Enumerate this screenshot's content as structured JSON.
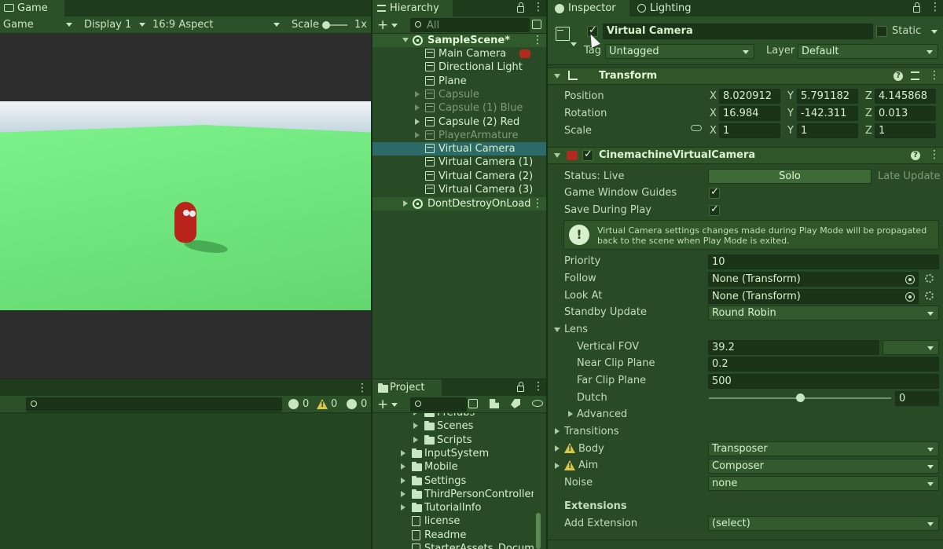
{
  "game": {
    "tab_label": "Game",
    "mode": "Game",
    "display": "Display 1",
    "aspect": "16:9 Aspect",
    "scale_label": "Scale",
    "scale_value": "1x"
  },
  "console": {
    "count_info": "0",
    "count_warn": "0",
    "count_error": "0"
  },
  "hierarchy": {
    "tab_label": "Hierarchy",
    "search_placeholder": "All",
    "scene": "SampleScene*",
    "items": [
      {
        "label": "Main Camera",
        "dim": false,
        "fold": false
      },
      {
        "label": "Directional Light",
        "dim": false,
        "fold": false
      },
      {
        "label": "Plane",
        "dim": false,
        "fold": false
      },
      {
        "label": "Capsule",
        "dim": true,
        "fold": true
      },
      {
        "label": "Capsule (1) Blue",
        "dim": true,
        "fold": true
      },
      {
        "label": "Capsule (2) Red",
        "dim": false,
        "fold": true
      },
      {
        "label": "PlayerArmature",
        "dim": true,
        "fold": true
      },
      {
        "label": "Virtual Camera",
        "dim": false,
        "fold": false,
        "selected": true
      },
      {
        "label": "Virtual Camera (1)",
        "dim": false,
        "fold": false
      },
      {
        "label": "Virtual Camera (2)",
        "dim": false,
        "fold": false
      },
      {
        "label": "Virtual Camera (3)",
        "dim": false,
        "fold": false
      }
    ],
    "dontdestroy": "DontDestroyOnLoad"
  },
  "project": {
    "tab_label": "Project",
    "items": [
      {
        "label": "Prefabs",
        "type": "folder",
        "indent": 2
      },
      {
        "label": "Scenes",
        "type": "folder",
        "indent": 2
      },
      {
        "label": "Scripts",
        "type": "folder",
        "indent": 2
      },
      {
        "label": "InputSystem",
        "type": "folder",
        "indent": 1
      },
      {
        "label": "Mobile",
        "type": "folder",
        "indent": 1
      },
      {
        "label": "Settings",
        "type": "folder",
        "indent": 1
      },
      {
        "label": "ThirdPersonController",
        "type": "folder",
        "indent": 1
      },
      {
        "label": "TutorialInfo",
        "type": "folder",
        "indent": 1
      },
      {
        "label": "license",
        "type": "file",
        "indent": 1
      },
      {
        "label": "Readme",
        "type": "asset",
        "indent": 1
      },
      {
        "label": "StarterAssets_Documen",
        "type": "file",
        "indent": 1
      }
    ]
  },
  "inspector": {
    "tab_inspector": "Inspector",
    "tab_lighting": "Lighting",
    "object_name": "Virtual Camera",
    "static_label": "Static",
    "tag_label": "Tag",
    "tag_value": "Untagged",
    "layer_label": "Layer",
    "layer_value": "Default",
    "transform": {
      "title": "Transform",
      "position_label": "Position",
      "rotation_label": "Rotation",
      "scale_label": "Scale",
      "pos": [
        "8.020912",
        "5.791182",
        "4.145868"
      ],
      "rot": [
        "16.984",
        "-142.311",
        "0.013"
      ],
      "scl": [
        "1",
        "1",
        "1"
      ],
      "x": "X",
      "y": "Y",
      "z": "Z"
    },
    "cinemachine": {
      "title": "CinemachineVirtualCamera",
      "status": "Status: Live",
      "solo": "Solo",
      "late_update": "Late Update",
      "guides_label": "Game Window Guides",
      "save_label": "Save During Play",
      "info": "Virtual Camera settings changes made during Play Mode will be propagated back to the scene when Play Mode is exited.",
      "priority_label": "Priority",
      "priority_value": "10",
      "follow_label": "Follow",
      "follow_value": "None (Transform)",
      "lookat_label": "Look At",
      "lookat_value": "None (Transform)",
      "standby_label": "Standby Update",
      "standby_value": "Round Robin",
      "lens_label": "Lens",
      "fov_label": "Vertical FOV",
      "fov_value": "39.2",
      "near_label": "Near Clip Plane",
      "near_value": "0.2",
      "far_label": "Far Clip Plane",
      "far_value": "500",
      "dutch_label": "Dutch",
      "dutch_value": "0",
      "advanced_label": "Advanced",
      "transitions_label": "Transitions",
      "body_label": "Body",
      "body_value": "Transposer",
      "aim_label": "Aim",
      "aim_value": "Composer",
      "noise_label": "Noise",
      "noise_value": "none",
      "extensions_label": "Extensions",
      "add_ext_label": "Add Extension",
      "add_ext_value": "(select)"
    }
  }
}
